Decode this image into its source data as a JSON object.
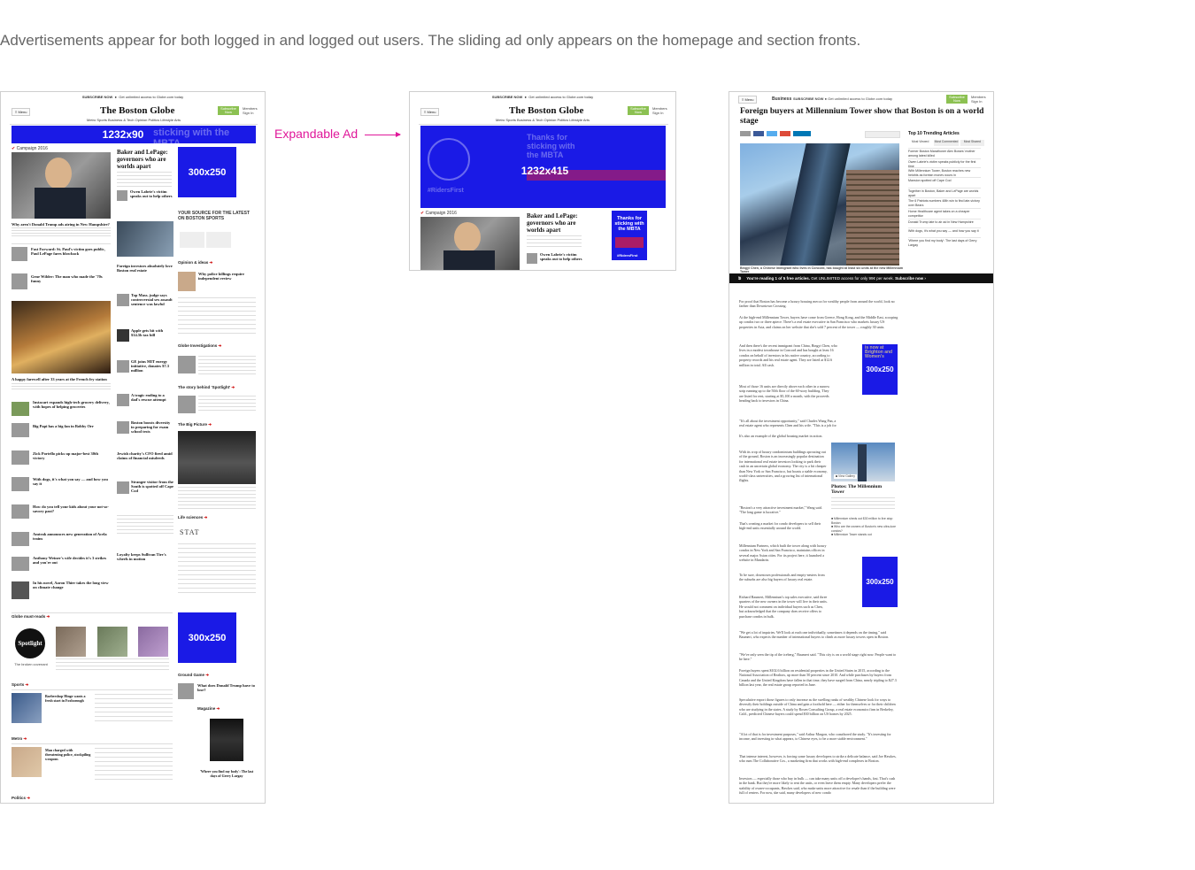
{
  "intro": "Advertisements appear for both logged in and logged out users. The sliding ad only appears on the homepage and section fronts.",
  "annotation": "Expandable Ad",
  "colors": {
    "ad_blue": "#1a1ae6",
    "annotation_pink": "#e0189a",
    "subscribe_green": "#8cc152",
    "accent_red": "#cc0000"
  },
  "common": {
    "subscribe_now": "SUBSCRIBE NOW",
    "get_access": "Get unlimited access to Globe.com today",
    "menu": "Menu",
    "logo": "The Boston Globe",
    "subscribe_btn": "Subscribe Now",
    "members_signin": "Members Sign In",
    "nav": "Metro   Sports   Business & Tech   Opinion   Politics   Lifestyle   Arts"
  },
  "home": {
    "leaderboard_label": "1232x90",
    "leaderboard_ghost": "sticking with the MBTA",
    "campaign": "Campaign 2016",
    "lead_headline": "Baker and LePage: governors who are worlds apart",
    "mr_label": "300x250",
    "owen": "Owen Labrie's victim speaks out to help others",
    "why_arent": "Why aren't Donald Trump ads airing in New Hampshire?",
    "fast_forward": "Fast Forward: St. Paul's victim goes public, Paul LePage fares blowback",
    "gene_wilder": "Gene Wilder: The man who made the '70s funny",
    "foreign_investors": "Foreign investors absolutely love Boston real estate",
    "opinion": "Opinion & ideas",
    "police_killings": "Why police killings require independent review",
    "top_mass": "Top Mass. judge says controversial sex assault sentence was lawful",
    "apple": "Apple gets hit with $14.5b tax bill",
    "ge": "GE joins MIT energy initiative, donates $7.3 million",
    "farewell": "A happy farewell after 33 years at the French fry station",
    "globe_investigations": "Globe Investigations",
    "instacart": "Instacart expands high-tech grocery delivery, with hopes of helping groceries",
    "big_papi": "Big Papi has a big fan in Bobby Orr",
    "rescue": "A tragic ending to a dad's rescue attempt",
    "story_behind": "The story behind 'Spotlight'",
    "boston_boosts": "Boston boosts diversity in preparing for exam school tests",
    "big_picture": "The Big Picture",
    "zick": "Zick Portello picks up major-best 30th victory",
    "dogs": "With dogs, it's what you say — and how you say it",
    "jewish": "Jewish charity's CFO fired amid claims of financial misdeeds",
    "stranger": "Stranger visitor from the South is spotted off Cape Cod",
    "kids_savory": "How do you tell your kids about your not-so-savory past?",
    "amtrak": "Amtrak announces new generation of Acela trains",
    "loyalty": "Loyalty keeps Sullivan Tire's wheels in motion",
    "life_sciences": "Life sciences",
    "stat": "STAT",
    "anthony": "Anthony Weiner's wife decides it's 3 strikes and you're out",
    "thier": "In his novel, Aaron Thier takes the long view on climate change",
    "must_reads": "Globe must-reads",
    "spotlight": "Spotlight",
    "broken_covenant": "The broken covenant",
    "ground_game": "Ground Game",
    "ground_headline": "What does Donald Trump have to lose?",
    "magazine": "Magazine",
    "mag_caption": "'Where you find my body': The last days of Gerry Largay",
    "sports": "Sports",
    "barbershop": "Barbershop Hinge wants a fresh start in Foxborough",
    "metro": "Metro",
    "man_charged": "Man charged with threatening police, stockpiling weapons",
    "politics": "Politics"
  },
  "expand": {
    "ad_label": "1232x415",
    "ghost": "Thanks for sticking with the MBTA",
    "hashtag": "#RidersFirst",
    "side_ad": "Thanks for sticking with the MBTA",
    "side_tag": "#RidersFirst",
    "campaign": "Campaign 2016",
    "headline": "Baker and LePage: governors who are worlds apart",
    "owen": "Owen Labrie's victim speaks out to help others"
  },
  "article": {
    "section": "Business",
    "title": "Foreign buyers at Millennium Tower show that Boston is on a world stage",
    "trending_title": "Top 10 Trending Articles",
    "trending_tabs": [
      "Most Viewed",
      "Most Commented",
      "Most Shared"
    ],
    "trending": [
      "Former Boston Marathoner Alex Bowes' mother among latest killed",
      "Owen Labrie's victim speaks publicly for the first time",
      "Mansion spotted off Cape Cod",
      "With Millennium Tower, Boston reaches new heights as foreign money pours in",
      "Together in Boston, Baker and LePage are worlds apart",
      "The 6 Patriots numbers 48th win to find late-victory over Bears",
      "Home Healthcare agent takes on a cheaper competitor",
      "Donald Trump late to air ad in New Hampshire",
      "With dogs, it's what you say — and how you say it",
      "'Where you find my body': The last days of Gerry Largay"
    ],
    "caption": "Bingyi Chen, a Chinese immigrant who lives in Concord, has bought at least six units at the new Millennium Tower",
    "meter": "You're reading 1 of 5 free articles.",
    "meter_offer": "Get UNLIMITED access for only 99¢ per week.",
    "meter_cta": "Subscribe now ›",
    "ad_label_1": "300x250",
    "ad_ghost_1": "is now at Brighton and Women's",
    "photos_title": "Photos: The Millennium Tower",
    "view_gallery": "View Gallery",
    "related": [
      "Millennium sheds out $30 million to live atop Boston",
      "Who are the owners of Boston's new ultra-luxe condos?",
      "Millennium Tower stands out"
    ],
    "ad_label_2": "300x250",
    "paragraphs": [
      "For proof that Boston has become a luxury housing mecca for wealthy people from around the world, look no farther than Downtown Crossing.",
      "At the high-end Millennium Tower, buyers have come from Greece, Hong Kong, and the Middle East, scooping up condos two or three apiece. There's a real estate executive in San Francisco who markets luxury US properties in Asia, and claims on her website that she's sold 7 percent of the tower — roughly 30 units.",
      "And then there's the recent immigrant from China, Bingyi Chen, who lives in a modest townhouse in Concord and has bought at least 16 condos on behalf of investors in his native country, according to property records and his real estate agent. They are listed at $12.6 million in total. All cash.",
      "Most of those 16 units are directly above each other in a narrow strip running up to the 50th floor of the 60-story building. They are listed for rent, starting at $5,100 a month, with the proceeds heading back to investors in China.",
      "\"It's all about the investment opportunity,\" said Charles Wang Pan, a real estate agent who represents Chen and his wife. \"This is a job for them.\"",
      "It's also an example of the global housing market in action.",
      "With its crop of luxury condominium buildings sprouting out of the ground, Boston is an increasingly popular destination for international real estate investors looking to park their cash in an uncertain global economy. The city is a bit cheaper than New York or San Francisco, but boasts a stable economy, world-class universities, and a growing list of international flights.",
      "\"Boston's a very attractive investment market,\" Wang said. \"The long game is lucrative.\"",
      "That's creating a market for condo developers to sell their high-end units essentially around the world.",
      "Millennium Partners, which built the tower along with luxury condos in New York and San Francisco, maintains offices in several major Asian cities. For its project here, it launched a website in Mandarin.",
      "To be sure, downtown professionals and empty-nesters from the suburbs are also big buyers of luxury real estate.",
      "Richard Baumert, Millennium's top sales executive, said three quarters of the new owners in the tower will live in their units. He would not comment on individual buyers such as Chen, but acknowledged that the company does receive offers to purchase condos in bulk.",
      "\"We get a lot of inquiries. We'll look at each one individually, sometimes it depends on the timing,\" said Baumert, who expects the number of international buyers to climb as more luxury towers open in Boston.",
      "\"We've only seen the tip of the iceberg,\" Baumert said. \"This city is on a world stage right now. People want to be here.\"",
      "Foreign buyers spent $102.6 billion on residential properties in the United States in 2015, according to the National Association of Realtors, up more than 50 percent since 2010. And while purchases by buyers from Canada and the United Kingdom have fallen in that time, they have surged from China, nearly tripling to $27.3 billion last year, the real estate group reported in June.",
      "Speculative export those figures to only increase as the swelling ranks of wealthy Chinese look for ways to diversify their holdings outside of China and gain a foothold here — either for themselves or for their children who are studying in the states. A study by Rosen Consulting Group, a real estate economics firm in Berkeley, Calif., predicted Chinese buyers could spend $30 billion on US homes by 2025.",
      "\"A lot of that is for investment purposes,\" said Arthur Margon, who coauthored the study. \"It's investing for income, and investing in what appears, to Chinese eyes, to be a more stable environment.\"",
      "That intense interest, however, is forcing some luxury developers to strike a delicate balance, said Joe Hawkes, who runs The Collaborative Cos., a marketing firm that works with high-end complexes in Boston.",
      "Investors — especially those who buy in bulk — can take many units off a developer's hands, fast. That's cash in the bank. But they're more likely to rent the units, or even leave them empty. Many developers prefer the stability of owner-occupants, Hawkes said, who make units more attractive for resale than if the building were full of renters. For now, she said, many developers of new condo"
    ]
  }
}
